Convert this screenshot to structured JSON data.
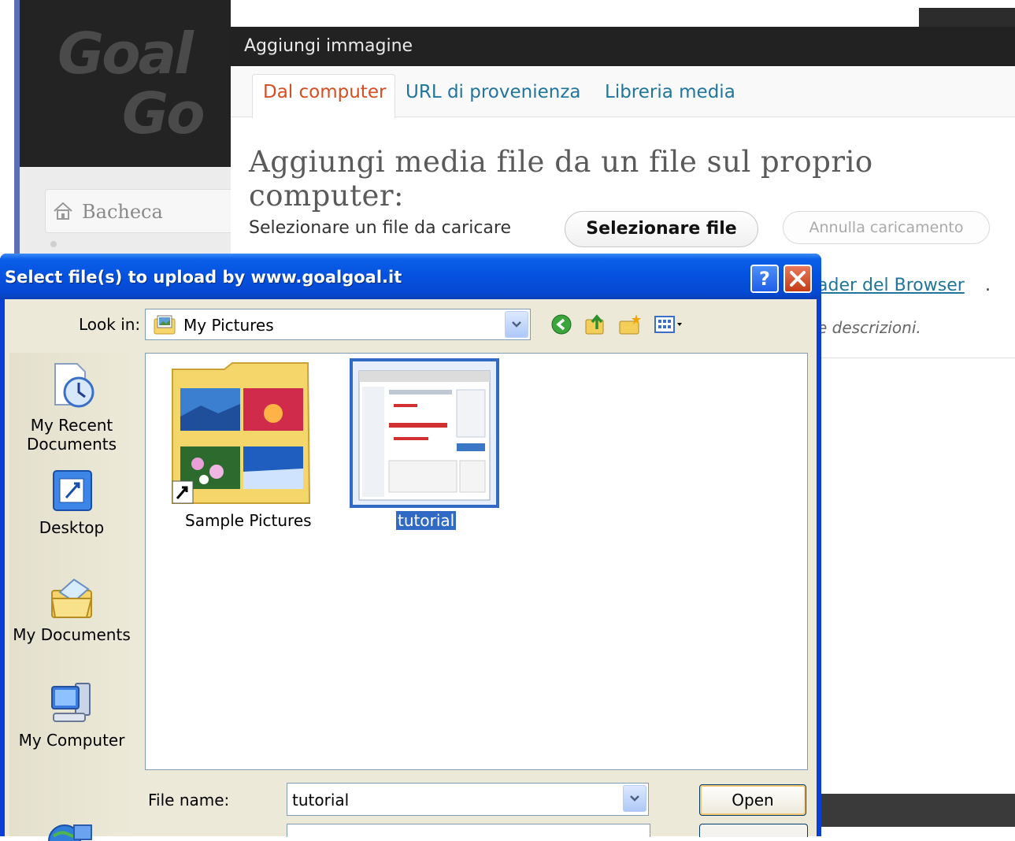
{
  "wordpress": {
    "logo_line1": "Goal",
    "logo_line2": "Go",
    "menu_item": "Bacheca"
  },
  "modal": {
    "title": "Aggiungi immagine",
    "tabs": [
      {
        "label": "Dal computer",
        "active": true
      },
      {
        "label": "URL di provenienza",
        "active": false
      },
      {
        "label": "Libreria media",
        "active": false
      }
    ],
    "heading": "Aggiungi media file da un file sul proprio computer:",
    "select_label": "Selezionare un file da caricare",
    "select_button": "Selezionare file",
    "cancel_button": "Annulla caricamento",
    "browser_link_partial": "ader del Browser",
    "browser_link_suffix": ".",
    "description_partial": "e descrizioni."
  },
  "dialog": {
    "title": "Select file(s) to upload by www.goalgoal.it",
    "look_in_label": "Look in:",
    "look_in_value": "My Pictures",
    "places": [
      {
        "label": "My Recent Documents",
        "icon": "recent-documents-icon"
      },
      {
        "label": "Desktop",
        "icon": "desktop-icon"
      },
      {
        "label": "My Documents",
        "icon": "my-documents-icon"
      },
      {
        "label": "My Computer",
        "icon": "my-computer-icon"
      }
    ],
    "files": [
      {
        "name": "Sample Pictures",
        "type": "folder-shortcut",
        "selected": false
      },
      {
        "name": "tutorial",
        "type": "image",
        "selected": true
      }
    ],
    "file_name_label": "File name:",
    "file_name_value": "tutorial",
    "open_button": "Open"
  },
  "colors": {
    "xp_title_blue": "#0551df",
    "xp_face": "#ece9d8",
    "wp_link": "#21759b",
    "wp_active_tab": "#d54e21",
    "selection": "#316ac5"
  }
}
